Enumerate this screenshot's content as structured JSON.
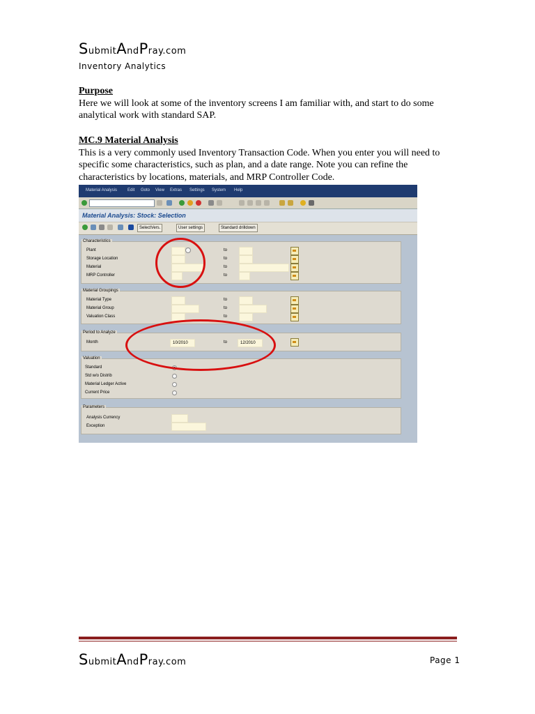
{
  "header": {
    "brand": {
      "s1": "S",
      "s2": "ubmit",
      "a1": "A",
      "a2": "nd",
      "p1": "P",
      "p2": "ray.com"
    },
    "subtitle": "Inventory Analytics"
  },
  "sections": [
    {
      "heading": "Purpose",
      "text": "Here we will look at some of the inventory screens I am familiar with, and start to do some analytical work with standard SAP."
    },
    {
      "heading": "MC.9 Material Analysis",
      "text": "This is a very commonly used Inventory Transaction Code.  When you enter you will need to specific some characteristics, such as plan, and a date range.  Note you can refine the characteristics by locations, materials, and MRP Controller Code."
    }
  ],
  "sap": {
    "menu": [
      "Material Analysis",
      "Edit",
      "Goto",
      "View",
      "Extras",
      "Settings",
      "System",
      "Help"
    ],
    "title": "Material Analysis: Stock: Selection",
    "app_buttons": [
      "SelectVers.",
      "User settings",
      "Standard drilldown"
    ],
    "groups": {
      "characteristics": {
        "title": "Characteristics",
        "rows": [
          "Plant",
          "Storage Location",
          "Material",
          "MRP Controller"
        ]
      },
      "material_groupings": {
        "title": "Material Groupings",
        "rows": [
          "Material Type",
          "Material Group",
          "Valuation Class"
        ]
      },
      "period": {
        "title": "Period to Analyze",
        "rows": [
          "Month"
        ],
        "from": "10/2010",
        "to": "12/2010"
      },
      "valuation": {
        "title": "Valuation",
        "rows": [
          "Standard",
          "Std w/o Distrib",
          "Material Ledger Active",
          "Current Price"
        ],
        "selected": "Standard"
      },
      "parameters": {
        "title": "Parameters",
        "rows": [
          "Analysis Currency",
          "Exception"
        ]
      }
    },
    "to_label": "to",
    "colors": {
      "menubar": "#1f3b70",
      "title": "#1b4a8f",
      "highlight": "#d81010"
    }
  },
  "footer": {
    "brand": {
      "s1": "S",
      "s2": "ubmit",
      "a1": "A",
      "a2": "nd",
      "p1": "P",
      "p2": "ray.com"
    },
    "page_label": "Page 1"
  }
}
